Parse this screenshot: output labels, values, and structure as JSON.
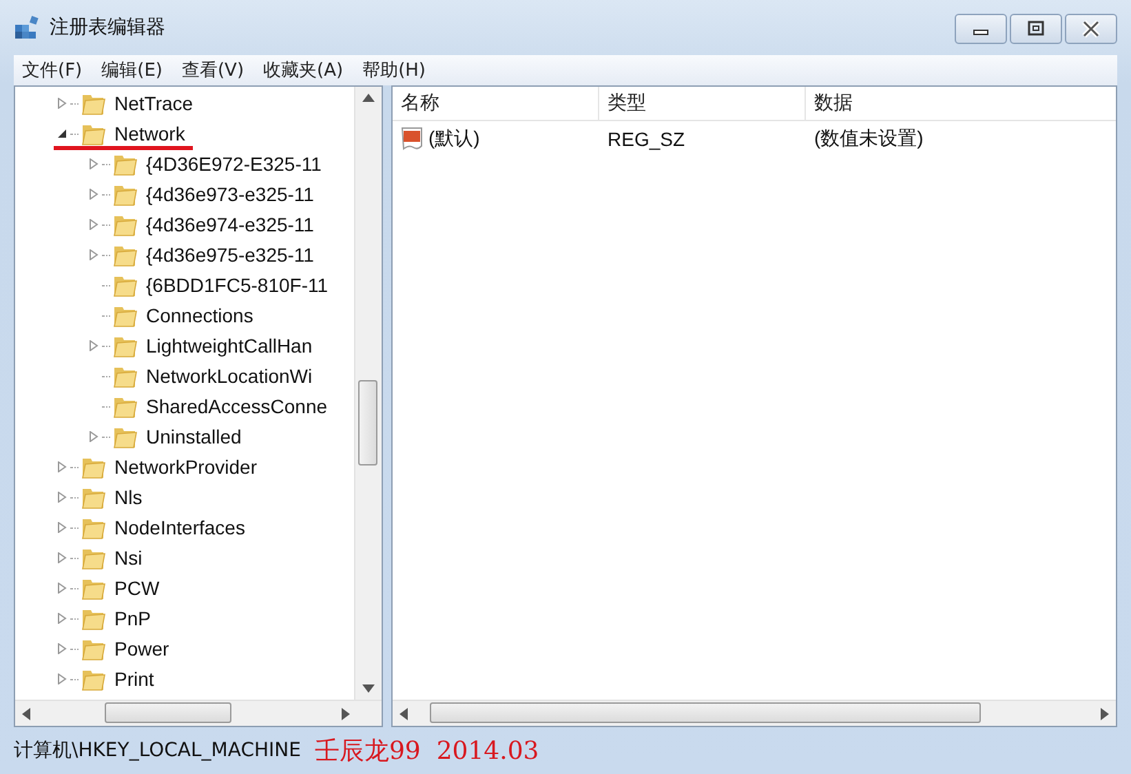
{
  "window": {
    "title": "注册表编辑器"
  },
  "menu": [
    "文件(F)",
    "编辑(E)",
    "查看(V)",
    "收藏夹(A)",
    "帮助(H)"
  ],
  "tree": [
    {
      "label": "NetTrace",
      "expanded": false,
      "annotated": false
    },
    {
      "label": "Network",
      "expanded": true,
      "annotated": true,
      "children": [
        {
          "label": "{4D36E972-E325-11",
          "expanded": false,
          "annotated": false
        },
        {
          "label": "{4d36e973-e325-11",
          "expanded": false,
          "annotated": false
        },
        {
          "label": "{4d36e974-e325-11",
          "expanded": false,
          "annotated": false
        },
        {
          "label": "{4d36e975-e325-11",
          "expanded": false,
          "annotated": false
        },
        {
          "label": "{6BDD1FC5-810F-11",
          "annotated": false
        },
        {
          "label": "Connections",
          "annotated": false
        },
        {
          "label": "LightweightCallHan",
          "expanded": false,
          "annotated": false
        },
        {
          "label": "NetworkLocationWi",
          "annotated": false
        },
        {
          "label": "SharedAccessConne",
          "annotated": false
        },
        {
          "label": "Uninstalled",
          "expanded": false,
          "annotated": false
        }
      ]
    },
    {
      "label": "NetworkProvider",
      "expanded": false,
      "annotated": false
    },
    {
      "label": "Nls",
      "expanded": false,
      "annotated": false
    },
    {
      "label": "NodeInterfaces",
      "expanded": false,
      "annotated": false
    },
    {
      "label": "Nsi",
      "expanded": false,
      "annotated": false
    },
    {
      "label": "PCW",
      "expanded": false,
      "annotated": false
    },
    {
      "label": "PnP",
      "expanded": false,
      "annotated": false
    },
    {
      "label": "Power",
      "expanded": false,
      "annotated": false
    },
    {
      "label": "Print",
      "expanded": false,
      "annotated": false
    }
  ],
  "table": {
    "columns": [
      "名称",
      "类型",
      "数据"
    ],
    "rows": [
      {
        "name": "(默认)",
        "type": "REG_SZ",
        "data": "(数值未设置)"
      }
    ]
  },
  "status_bar": {
    "path": "计算机\\HKEY_LOCAL_MACHINE",
    "annotation": "壬辰龙99  2014.03"
  }
}
